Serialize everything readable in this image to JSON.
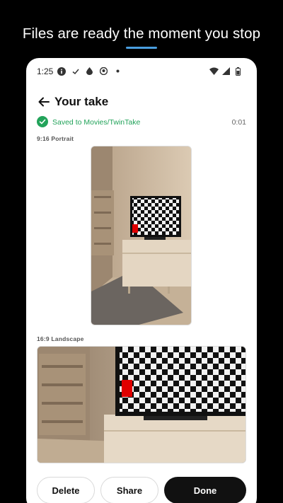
{
  "headline": "Files are ready the moment you stop",
  "status_bar": {
    "time": "1:25"
  },
  "app_bar": {
    "title": "Your take"
  },
  "saved": {
    "message": "Saved to Movies/TwinTake",
    "duration": "0:01"
  },
  "portrait": {
    "label": "9:16 Portrait"
  },
  "landscape": {
    "label": "16:9 Landscape"
  },
  "actions": {
    "delete": "Delete",
    "share": "Share",
    "done": "Done"
  },
  "colors": {
    "accent_green": "#22a35a",
    "headline_underline": "#4a9fe0",
    "primary_button": "#111111"
  }
}
